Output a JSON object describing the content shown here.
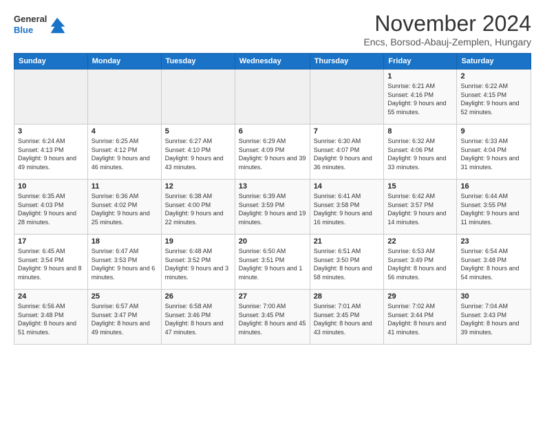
{
  "logo": {
    "general": "General",
    "blue": "Blue"
  },
  "header": {
    "title": "November 2024",
    "subtitle": "Encs, Borsod-Abauj-Zemplen, Hungary"
  },
  "weekdays": [
    "Sunday",
    "Monday",
    "Tuesday",
    "Wednesday",
    "Thursday",
    "Friday",
    "Saturday"
  ],
  "weeks": [
    [
      {
        "date": "",
        "info": ""
      },
      {
        "date": "",
        "info": ""
      },
      {
        "date": "",
        "info": ""
      },
      {
        "date": "",
        "info": ""
      },
      {
        "date": "",
        "info": ""
      },
      {
        "date": "1",
        "info": "Sunrise: 6:21 AM\nSunset: 4:16 PM\nDaylight: 9 hours and 55 minutes."
      },
      {
        "date": "2",
        "info": "Sunrise: 6:22 AM\nSunset: 4:15 PM\nDaylight: 9 hours and 52 minutes."
      }
    ],
    [
      {
        "date": "3",
        "info": "Sunrise: 6:24 AM\nSunset: 4:13 PM\nDaylight: 9 hours and 49 minutes."
      },
      {
        "date": "4",
        "info": "Sunrise: 6:25 AM\nSunset: 4:12 PM\nDaylight: 9 hours and 46 minutes."
      },
      {
        "date": "5",
        "info": "Sunrise: 6:27 AM\nSunset: 4:10 PM\nDaylight: 9 hours and 43 minutes."
      },
      {
        "date": "6",
        "info": "Sunrise: 6:29 AM\nSunset: 4:09 PM\nDaylight: 9 hours and 39 minutes."
      },
      {
        "date": "7",
        "info": "Sunrise: 6:30 AM\nSunset: 4:07 PM\nDaylight: 9 hours and 36 minutes."
      },
      {
        "date": "8",
        "info": "Sunrise: 6:32 AM\nSunset: 4:06 PM\nDaylight: 9 hours and 33 minutes."
      },
      {
        "date": "9",
        "info": "Sunrise: 6:33 AM\nSunset: 4:04 PM\nDaylight: 9 hours and 31 minutes."
      }
    ],
    [
      {
        "date": "10",
        "info": "Sunrise: 6:35 AM\nSunset: 4:03 PM\nDaylight: 9 hours and 28 minutes."
      },
      {
        "date": "11",
        "info": "Sunrise: 6:36 AM\nSunset: 4:02 PM\nDaylight: 9 hours and 25 minutes."
      },
      {
        "date": "12",
        "info": "Sunrise: 6:38 AM\nSunset: 4:00 PM\nDaylight: 9 hours and 22 minutes."
      },
      {
        "date": "13",
        "info": "Sunrise: 6:39 AM\nSunset: 3:59 PM\nDaylight: 9 hours and 19 minutes."
      },
      {
        "date": "14",
        "info": "Sunrise: 6:41 AM\nSunset: 3:58 PM\nDaylight: 9 hours and 16 minutes."
      },
      {
        "date": "15",
        "info": "Sunrise: 6:42 AM\nSunset: 3:57 PM\nDaylight: 9 hours and 14 minutes."
      },
      {
        "date": "16",
        "info": "Sunrise: 6:44 AM\nSunset: 3:55 PM\nDaylight: 9 hours and 11 minutes."
      }
    ],
    [
      {
        "date": "17",
        "info": "Sunrise: 6:45 AM\nSunset: 3:54 PM\nDaylight: 9 hours and 8 minutes."
      },
      {
        "date": "18",
        "info": "Sunrise: 6:47 AM\nSunset: 3:53 PM\nDaylight: 9 hours and 6 minutes."
      },
      {
        "date": "19",
        "info": "Sunrise: 6:48 AM\nSunset: 3:52 PM\nDaylight: 9 hours and 3 minutes."
      },
      {
        "date": "20",
        "info": "Sunrise: 6:50 AM\nSunset: 3:51 PM\nDaylight: 9 hours and 1 minute."
      },
      {
        "date": "21",
        "info": "Sunrise: 6:51 AM\nSunset: 3:50 PM\nDaylight: 8 hours and 58 minutes."
      },
      {
        "date": "22",
        "info": "Sunrise: 6:53 AM\nSunset: 3:49 PM\nDaylight: 8 hours and 56 minutes."
      },
      {
        "date": "23",
        "info": "Sunrise: 6:54 AM\nSunset: 3:48 PM\nDaylight: 8 hours and 54 minutes."
      }
    ],
    [
      {
        "date": "24",
        "info": "Sunrise: 6:56 AM\nSunset: 3:48 PM\nDaylight: 8 hours and 51 minutes."
      },
      {
        "date": "25",
        "info": "Sunrise: 6:57 AM\nSunset: 3:47 PM\nDaylight: 8 hours and 49 minutes."
      },
      {
        "date": "26",
        "info": "Sunrise: 6:58 AM\nSunset: 3:46 PM\nDaylight: 8 hours and 47 minutes."
      },
      {
        "date": "27",
        "info": "Sunrise: 7:00 AM\nSunset: 3:45 PM\nDaylight: 8 hours and 45 minutes."
      },
      {
        "date": "28",
        "info": "Sunrise: 7:01 AM\nSunset: 3:45 PM\nDaylight: 8 hours and 43 minutes."
      },
      {
        "date": "29",
        "info": "Sunrise: 7:02 AM\nSunset: 3:44 PM\nDaylight: 8 hours and 41 minutes."
      },
      {
        "date": "30",
        "info": "Sunrise: 7:04 AM\nSunset: 3:43 PM\nDaylight: 8 hours and 39 minutes."
      }
    ]
  ]
}
